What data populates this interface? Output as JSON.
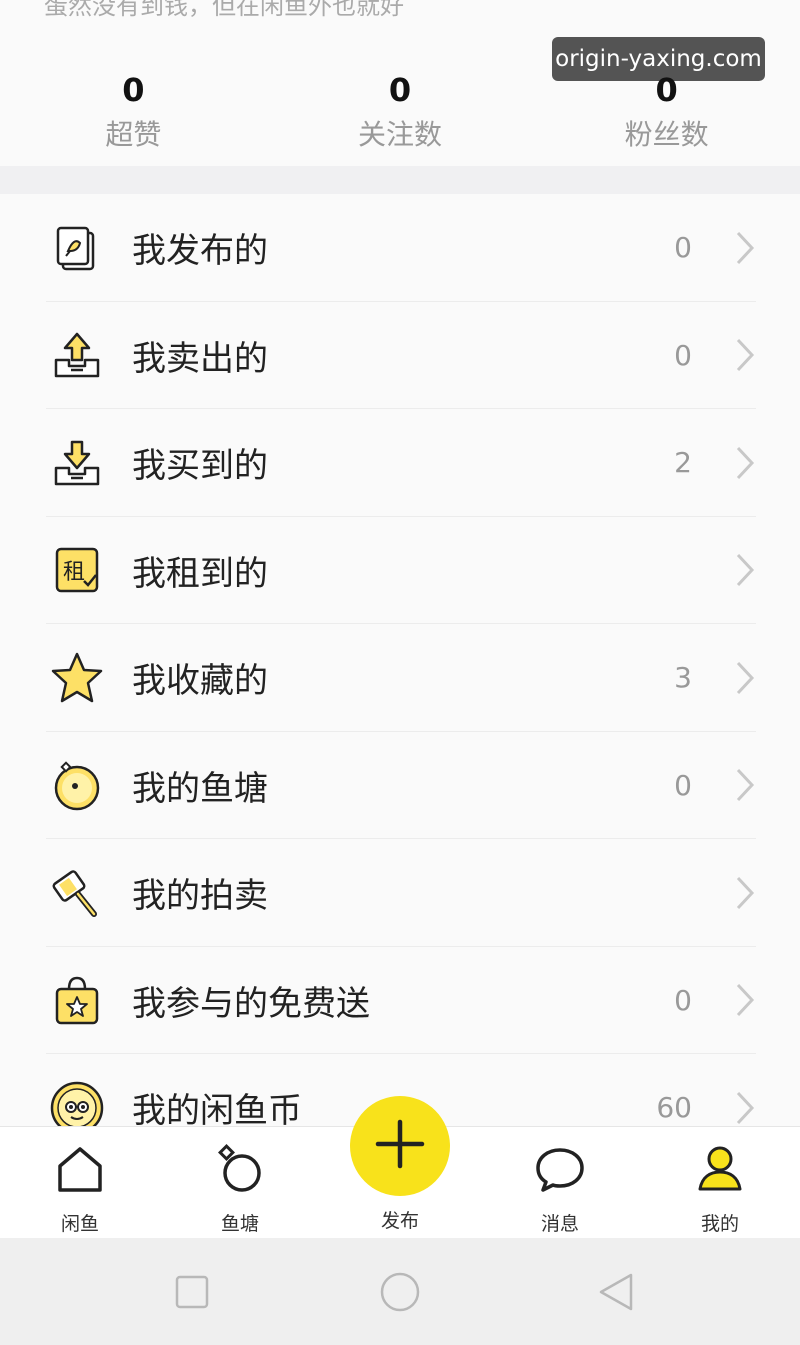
{
  "top_partial_text": "蛋然没有到钱，但在闲鱼外也就好",
  "watermark": "origin-yaxing.com",
  "stats": [
    {
      "value": "0",
      "label": "超赞"
    },
    {
      "value": "0",
      "label": "关注数"
    },
    {
      "value": "0",
      "label": "粉丝数"
    }
  ],
  "menu": [
    {
      "label": "我发布的",
      "count": "0",
      "icon": "published-doc-icon"
    },
    {
      "label": "我卖出的",
      "count": "0",
      "icon": "sold-tray-icon"
    },
    {
      "label": "我买到的",
      "count": "2",
      "icon": "bought-tray-icon"
    },
    {
      "label": "我租到的",
      "count": "",
      "icon": "rent-icon",
      "icon_text": "租"
    },
    {
      "label": "我收藏的",
      "count": "3",
      "icon": "star-icon"
    },
    {
      "label": "我的鱼塘",
      "count": "0",
      "icon": "fishpond-icon"
    },
    {
      "label": "我的拍卖",
      "count": "",
      "icon": "auction-hammer-icon"
    },
    {
      "label": "我参与的免费送",
      "count": "0",
      "icon": "gift-bag-icon"
    },
    {
      "label": "我的闲鱼币",
      "count": "60",
      "icon": "fish-coin-icon"
    }
  ],
  "tabs": [
    {
      "label": "闲鱼",
      "icon": "home-icon"
    },
    {
      "label": "鱼塘",
      "icon": "pond-ring-icon"
    },
    {
      "label": "消息",
      "icon": "message-bubble-icon"
    },
    {
      "label": "我的",
      "icon": "profile-person-icon"
    }
  ],
  "publish": {
    "label": "发布",
    "icon": "plus-icon"
  },
  "colors": {
    "accent": "#f8e21b",
    "icon_fill": "#fde066",
    "text": "#222222",
    "muted": "#999999"
  }
}
